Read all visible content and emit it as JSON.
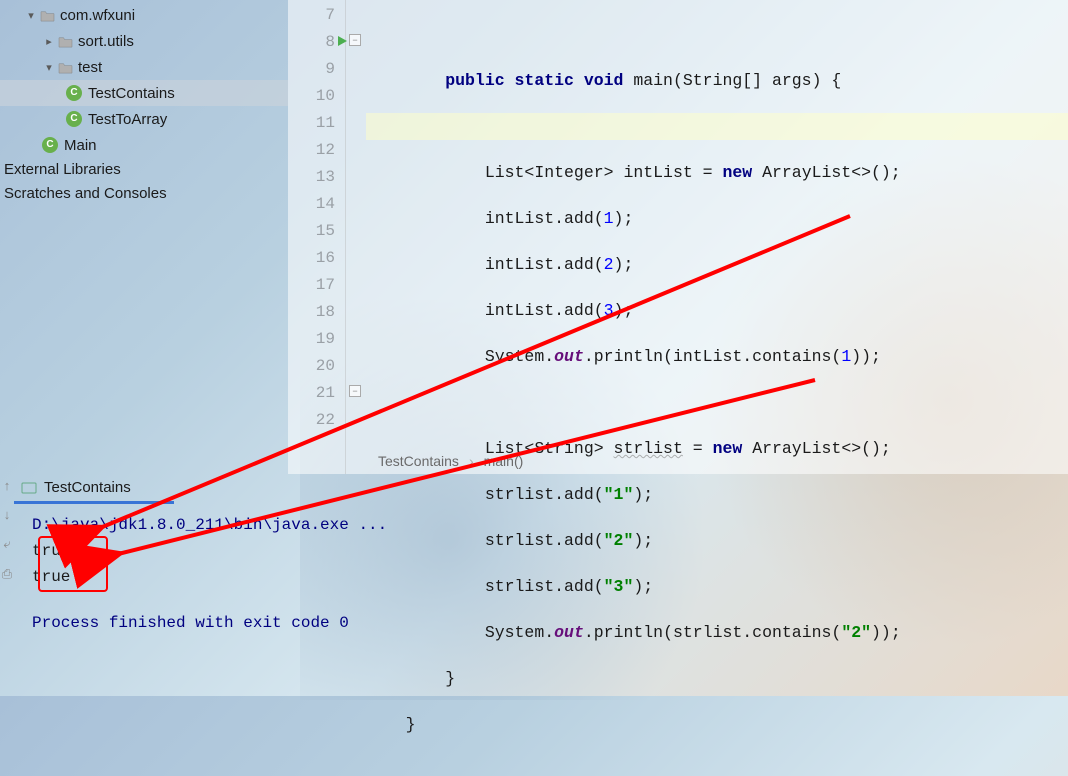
{
  "tree": {
    "items": [
      {
        "label": "com.wfxuni",
        "kind": "folder",
        "indent": 1,
        "arrow": "▾"
      },
      {
        "label": "sort.utils",
        "kind": "folder",
        "indent": 2,
        "arrow": "▸"
      },
      {
        "label": "test",
        "kind": "folder",
        "indent": 2,
        "arrow": "▾"
      },
      {
        "label": "TestContains",
        "kind": "class",
        "indent": 3,
        "arrow": "",
        "selected": true
      },
      {
        "label": "TestToArray",
        "kind": "class",
        "indent": 3,
        "arrow": ""
      },
      {
        "label": "Main",
        "kind": "class",
        "indent": 2,
        "arrow": ""
      }
    ],
    "ext_lib": "External Libraries",
    "scratches": "Scratches and Consoles"
  },
  "editor": {
    "first_line": 7,
    "lines": [
      "",
      "        public static void main(String[] args) {",
      "",
      "            List<Integer> intList = new ArrayList<>();",
      "            intList.add(1);",
      "            intList.add(2);",
      "            intList.add(3);",
      "            System.out.println(intList.contains(1));",
      "",
      "            List<String> strlist = new ArrayList<>();",
      "            strlist.add(\"1\");",
      "            strlist.add(\"2\");",
      "            strlist.add(\"3\");",
      "            System.out.println(strlist.contains(\"2\"));",
      "        }",
      "    }"
    ],
    "breadcrumb": {
      "a": "TestContains",
      "b": "main()"
    }
  },
  "run": {
    "tab": "TestContains",
    "cmd": "D:\\java\\jdk1.8.0_211\\bin\\java.exe ...",
    "out1": "true",
    "out2": "true",
    "exit": "Process finished with exit code 0"
  }
}
